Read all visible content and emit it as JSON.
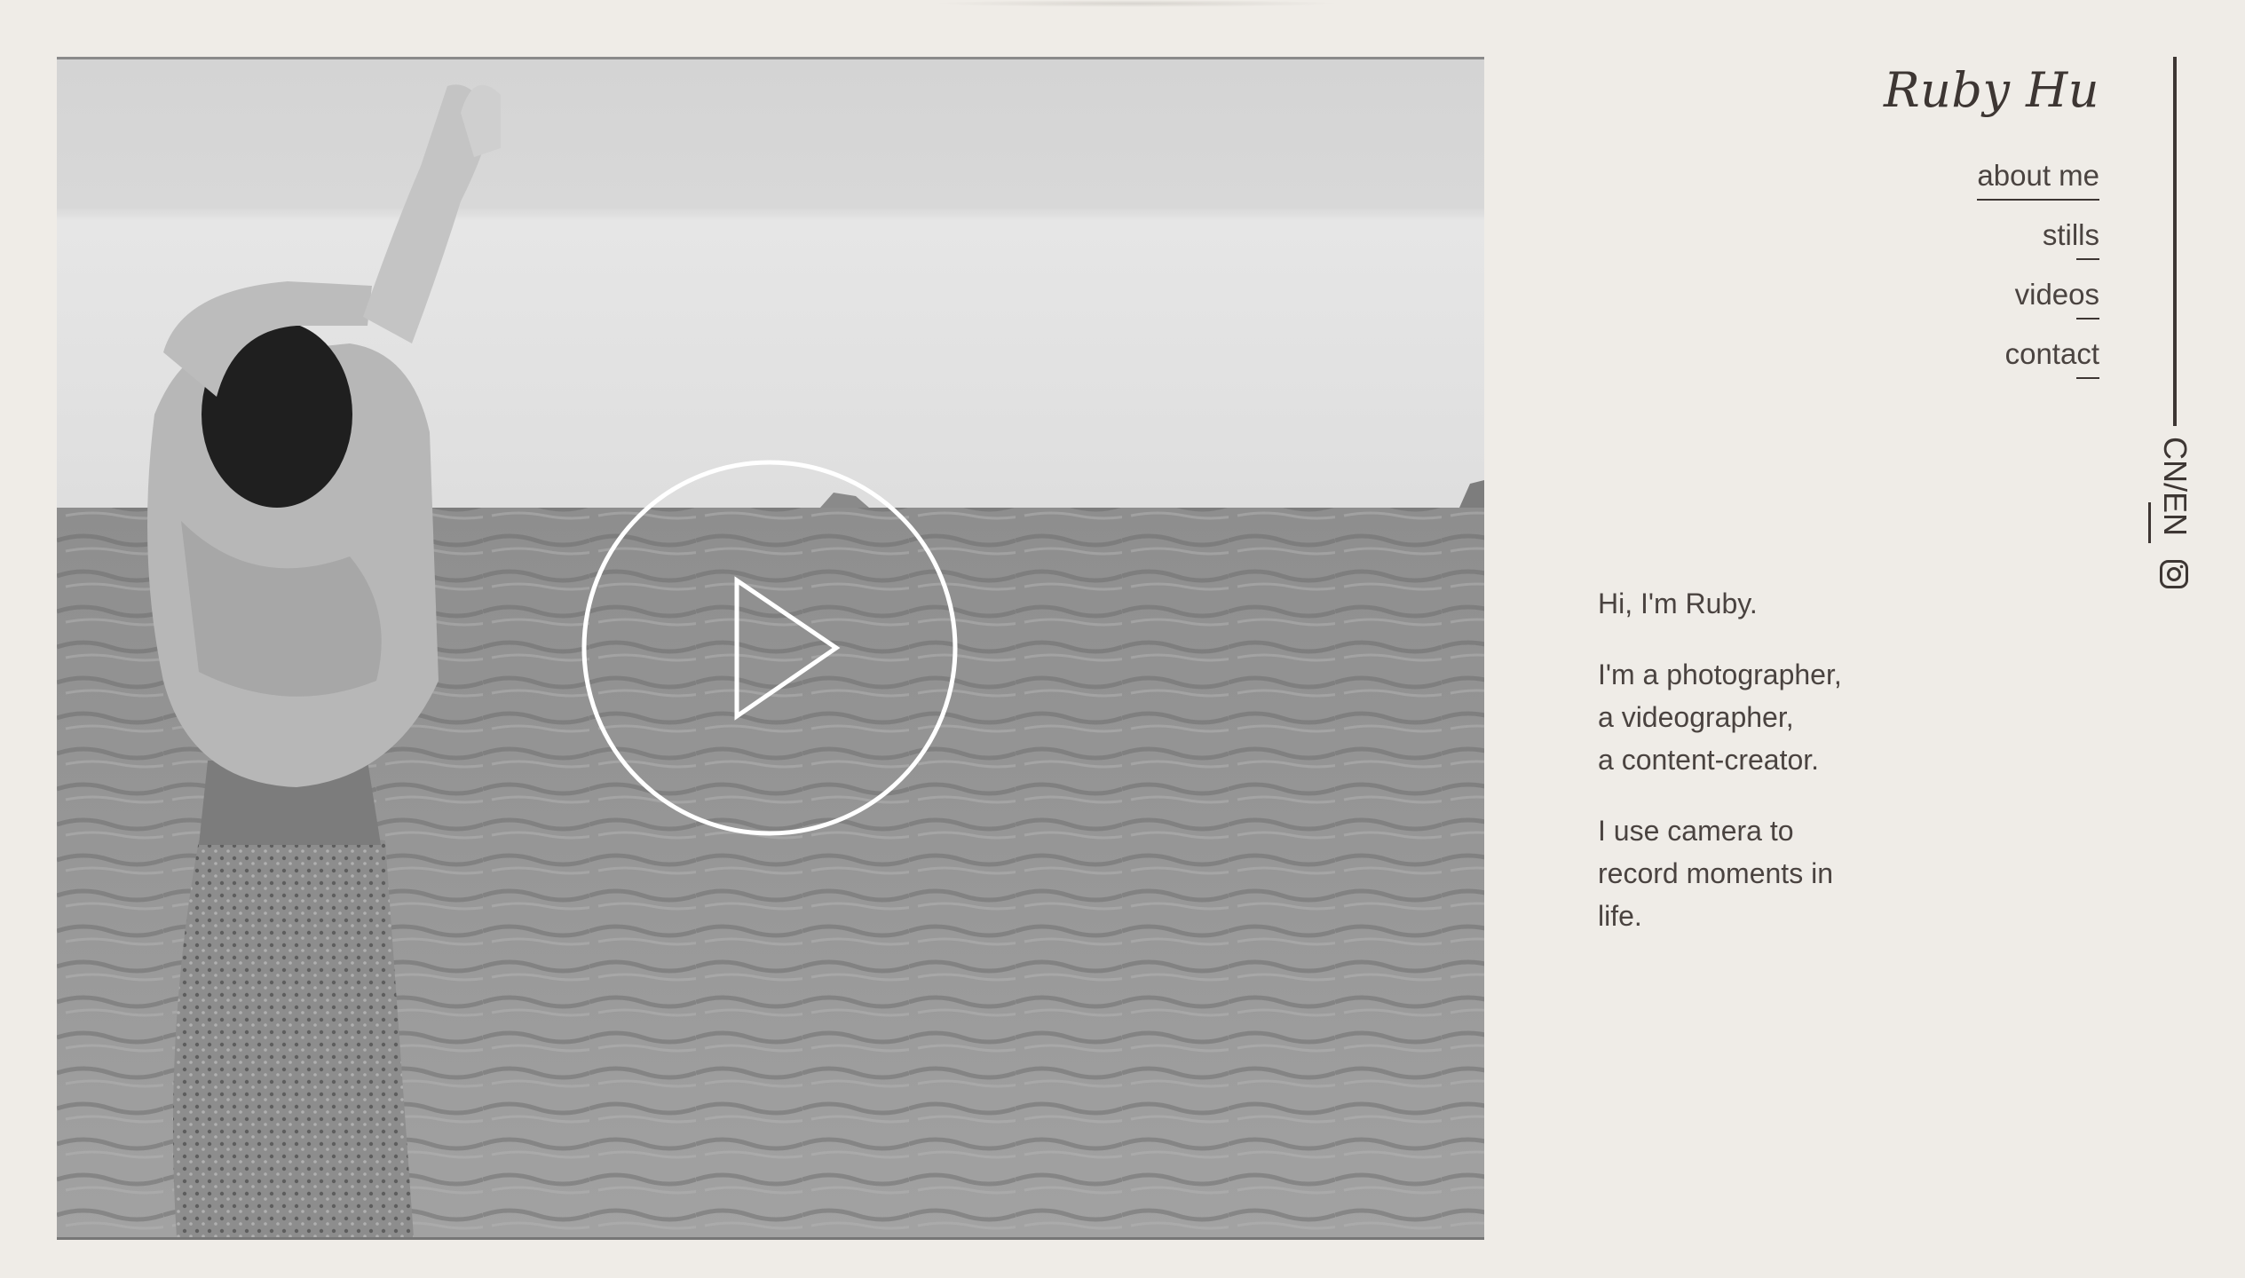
{
  "brand": {
    "name": "Ruby Hu"
  },
  "nav": {
    "items": [
      {
        "label": "about me"
      },
      {
        "label": "stills"
      },
      {
        "label": "videos"
      },
      {
        "label": "contact"
      }
    ]
  },
  "language_toggle": {
    "label": "CN/EN"
  },
  "social": {
    "instagram_icon": "instagram-icon"
  },
  "video": {
    "play_icon": "play-icon"
  },
  "intro": {
    "greeting": "Hi, I'm Ruby.",
    "role_lines": [
      "I'm a photographer,",
      "a videographer,",
      "a content-creator."
    ],
    "purpose_lines": [
      "I use camera to",
      "record moments in",
      "life."
    ]
  },
  "colors": {
    "background": "#efece7",
    "text": "#3d3633",
    "play_outline": "#ffffff"
  }
}
